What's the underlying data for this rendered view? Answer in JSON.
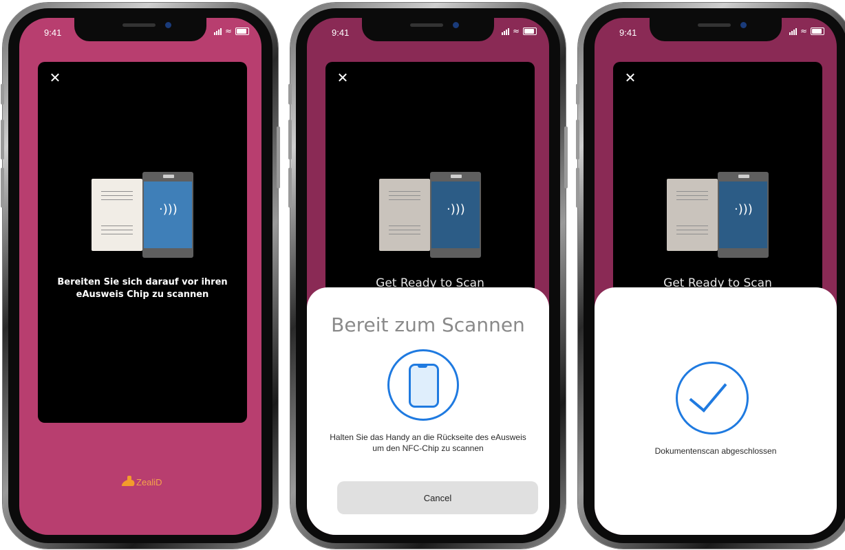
{
  "phones": [
    {
      "status_time": "9:41",
      "card": {
        "prompt": "Bereiten Sie sich darauf vor ihren eAusweis Chip zu scannen"
      },
      "brand": "ZealiD"
    },
    {
      "status_time": "9:41",
      "card": {
        "prompt": "Get Ready to Scan"
      },
      "sheet": {
        "title": "Bereit zum Scannen",
        "message": "Halten Sie das Handy an die Rückseite des eAusweis um den NFC-Chip zu scannen",
        "cancel_label": "Cancel"
      }
    },
    {
      "status_time": "9:41",
      "card": {
        "prompt": "Get Ready to Scan"
      },
      "sheet": {
        "status": "Dokumentenscan abgeschlossen"
      }
    }
  ],
  "icons": {
    "close": "close-icon",
    "nfc": "nfc-icon",
    "phone": "phone-icon",
    "check": "check-icon"
  },
  "colors": {
    "phone_screen_bg": "#b83e6f",
    "dimmed_screen_bg": "#8a2a55",
    "accent_blue": "#1f7ae0",
    "brand_orange": "#f39c2b"
  }
}
